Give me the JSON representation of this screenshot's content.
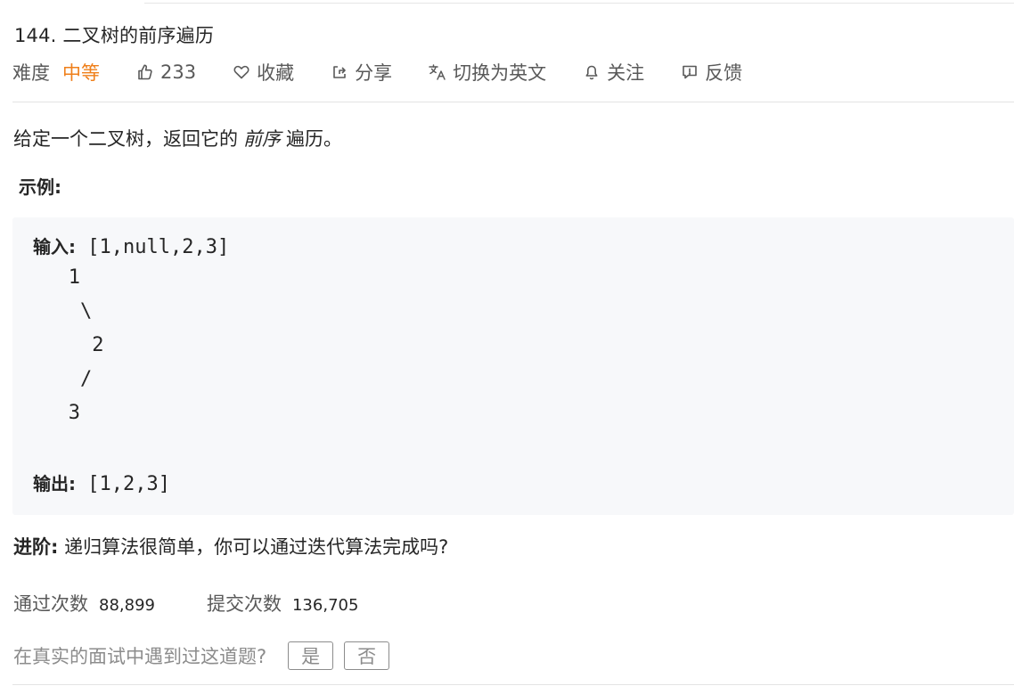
{
  "problem": {
    "title": "144. 二叉树的前序遍历",
    "difficulty_label": "难度",
    "difficulty_value": "中等",
    "likes": "233",
    "favorite_label": "收藏",
    "share_label": "分享",
    "switch_lang_label": "切换为英文",
    "follow_label": "关注",
    "feedback_label": "反馈"
  },
  "description": {
    "before": "给定一个二叉树，返回它的",
    "emphasis": "前序",
    "after": "遍历。"
  },
  "example": {
    "label": "示例:",
    "input_label": "输入:",
    "input_value": " [1,null,2,3]",
    "tree": [
      "   1",
      "    \\",
      "     2",
      "    /",
      "   3"
    ],
    "output_label": "输出:",
    "output_value": " [1,2,3]"
  },
  "advance": {
    "label": "进阶:",
    "text": " 递归算法很简单，你可以通过迭代算法完成吗?"
  },
  "stats": {
    "accepted_label": "通过次数",
    "accepted_value": "88,899",
    "submitted_label": "提交次数",
    "submitted_value": "136,705"
  },
  "interview": {
    "question": "在真实的面试中遇到过这道题?",
    "yes_label": "是",
    "no_label": "否"
  },
  "colors": {
    "difficulty": "#ef7f1a",
    "code_background": "#f7f8fa"
  },
  "icons": [
    "thumbs-up-icon",
    "heart-icon",
    "share-icon",
    "translate-icon",
    "bell-icon",
    "feedback-icon"
  ]
}
